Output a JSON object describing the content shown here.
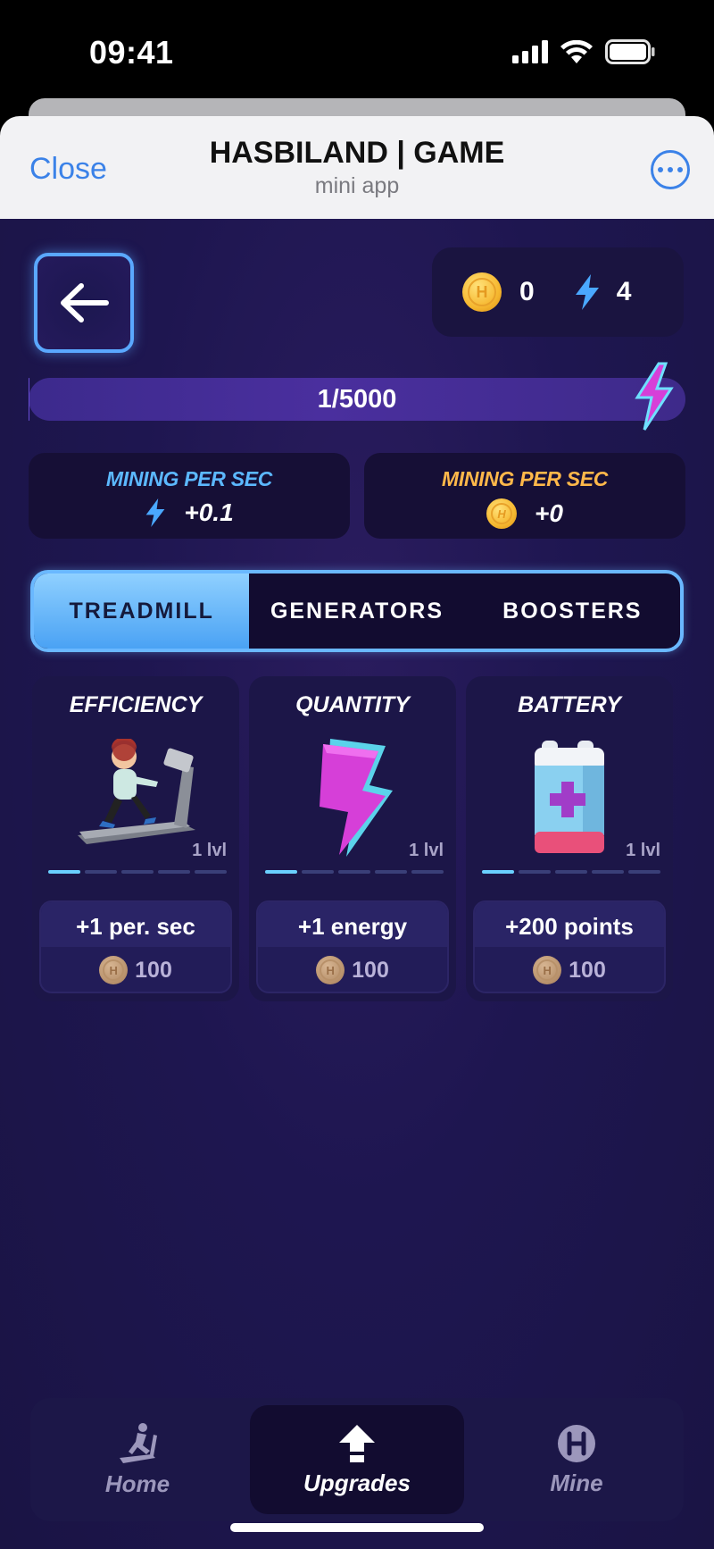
{
  "status_bar": {
    "time": "09:41"
  },
  "telegram": {
    "close_label": "Close",
    "title": "HASBILAND | GAME",
    "subtitle": "mini app"
  },
  "balance": {
    "coins": "0",
    "energy": "4"
  },
  "progress": {
    "label": "1/5000",
    "current": 1,
    "max": 5000
  },
  "mining": [
    {
      "title": "MINING PER SEC",
      "value": "+0.1",
      "icon": "lightning-icon",
      "color": "#5cb8ff"
    },
    {
      "title": "MINING PER SEC",
      "value": "+0",
      "icon": "coin-icon",
      "color": "#ffb84a"
    }
  ],
  "tabs": [
    {
      "label": "TREADMILL",
      "active": true
    },
    {
      "label": "GENERATORS",
      "active": false
    },
    {
      "label": "BOOSTERS",
      "active": false
    }
  ],
  "cards": [
    {
      "title": "EFFICIENCY",
      "image": "treadmill-runner-icon",
      "level": "1 lvl",
      "level_value": 1,
      "level_max": 5,
      "bonus": "+1 per. sec",
      "price": "100"
    },
    {
      "title": "QUANTITY",
      "image": "lightning-bolt-icon",
      "level": "1 lvl",
      "level_value": 1,
      "level_max": 5,
      "bonus": "+1 energy",
      "price": "100"
    },
    {
      "title": "BATTERY",
      "image": "battery-icon",
      "level": "1 lvl",
      "level_value": 1,
      "level_max": 5,
      "bonus": "+200 points",
      "price": "100"
    }
  ],
  "nav": [
    {
      "label": "Home",
      "icon": "treadmill-icon",
      "active": false
    },
    {
      "label": "Upgrades",
      "icon": "upgrade-arrow-icon",
      "active": true
    },
    {
      "label": "Mine",
      "icon": "h-coin-icon",
      "active": false
    }
  ],
  "colors": {
    "accent_blue": "#5aa8ff",
    "coin_gold": "#f6b830",
    "background": "#1e1650"
  }
}
